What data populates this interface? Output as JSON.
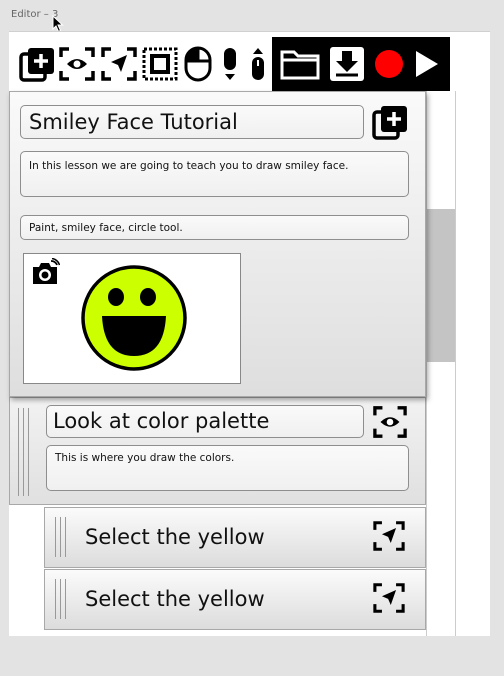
{
  "window": {
    "title": "Editor – 3"
  },
  "toolbar": {
    "icons": [
      "add-step-icon",
      "eye-focus-icon",
      "cursor-focus-icon",
      "region-select-icon",
      "mouse-icon",
      "scroll-down-icon",
      "scroll-icon",
      "folder-icon",
      "save-icon",
      "record-icon",
      "play-icon"
    ],
    "record_color": "#ff0000"
  },
  "tutorial": {
    "title": "Smiley Face Tutorial",
    "description": "In this lesson we are going to teach you to draw smiley face.",
    "tags": "Paint, smiley face, circle tool.",
    "preview": {
      "face_color": "#ccff00",
      "icon": "camera-icon"
    }
  },
  "steps": [
    {
      "title": "Look at color palette",
      "description": "This is where you draw the colors.",
      "icon": "eye-focus-icon",
      "substeps": [
        {
          "label": "Select the yellow",
          "icon": "cursor-focus-icon"
        },
        {
          "label": "Select the yellow",
          "icon": "cursor-focus-icon"
        }
      ]
    }
  ]
}
